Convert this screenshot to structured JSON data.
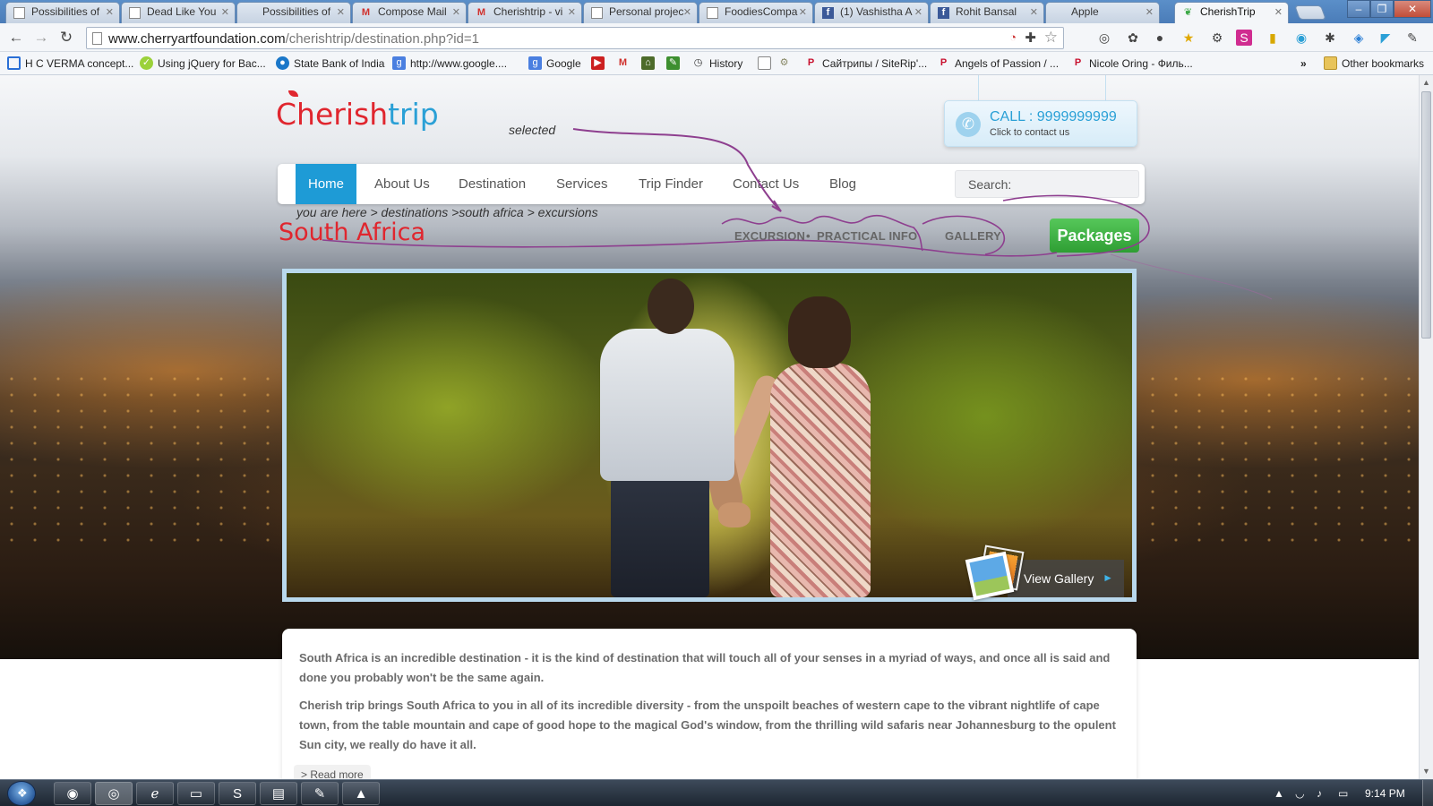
{
  "browser": {
    "tabs": [
      {
        "title": "Possibilities of",
        "icon": "page-icon"
      },
      {
        "title": "Dead Like You",
        "icon": "page-icon"
      },
      {
        "title": "Possibilities of",
        "icon": "page-icon"
      },
      {
        "title": "Compose Mail",
        "icon": "gmail-icon"
      },
      {
        "title": "Cherishtrip - vi",
        "icon": "gmail-icon"
      },
      {
        "title": "Personal projec",
        "icon": "page-icon"
      },
      {
        "title": "FoodiesCompa",
        "icon": "page-icon"
      },
      {
        "title": "(1) Vashistha A",
        "icon": "facebook-icon"
      },
      {
        "title": "Rohit Bansal",
        "icon": "facebook-icon"
      },
      {
        "title": "Apple",
        "icon": "apple-icon"
      },
      {
        "title": "CherishTrip",
        "icon": "leaf-icon"
      }
    ],
    "active_tab": 10,
    "url_host": "www.cherryartfoundation.com",
    "url_path": "/cherishtrip/destination.php?id=1",
    "bookmarks": [
      {
        "label": "H C VERMA concept...",
        "icon": "blue-square-icon"
      },
      {
        "label": "Using jQuery for Bac...",
        "icon": "green-circle-icon"
      },
      {
        "label": "State Bank of India",
        "icon": "sbi-icon"
      },
      {
        "label": "http://www.google....",
        "icon": "google-icon"
      },
      {
        "label": "Google",
        "icon": "google-icon"
      },
      {
        "label": "",
        "icon": "youtube-icon"
      },
      {
        "label": "",
        "icon": "gmail-icon"
      },
      {
        "label": "",
        "icon": "home-icon"
      },
      {
        "label": "",
        "icon": "evernote-icon"
      },
      {
        "label": "History",
        "icon": "history-icon"
      },
      {
        "label": "",
        "icon": "page-icon"
      },
      {
        "label": "",
        "icon": "lock-icon"
      },
      {
        "label": "Сайтрипы / SiteRip'...",
        "icon": "p-icon"
      },
      {
        "label": "Angels of Passion / ...",
        "icon": "p-icon"
      },
      {
        "label": "Nicole Oring - Филь...",
        "icon": "p-icon"
      },
      {
        "label": "Other bookmarks",
        "icon": "folder-icon"
      }
    ],
    "bookmarks_overflow": "»"
  },
  "site": {
    "logo_part1": "Cherish",
    "logo_part2": "trip",
    "annotation": "selected",
    "call_label": "CALL : 9999999999",
    "call_sub": "Click to contact us",
    "nav": [
      "Home",
      "About Us",
      "Destination",
      "Services",
      "Trip Finder",
      "Contact Us",
      "Blog"
    ],
    "nav_active": "Home",
    "search_placeholder": "Search:",
    "breadcrumb": "you are here > destinations >south africa > excursions",
    "title": "South Africa",
    "subnav": {
      "excursion": "EXCURSION",
      "sep": "•",
      "practical": "PRACTICAL INFO",
      "gallery": "GALLERY"
    },
    "packages_label": "Packages",
    "view_gallery": "View Gallery",
    "view_gallery_arrow": "►",
    "para1": "South Africa is an incredible destination - it is the kind of destination that will touch all of your senses in a myriad of ways, and once all is said and done you probably won't be the same again.",
    "para2": "Cherish trip brings South Africa to you in all of its incredible diversity - from the unspoilt beaches of western cape to the vibrant nightlife of cape town, from the table mountain and cape of good hope to the magical God's window, from the thrilling wild safaris near Johannesburg to the opulent Sun city, we really do have it all.",
    "read_more": "> Read more"
  },
  "taskbar": {
    "apps": [
      "firefox-icon",
      "chrome-icon",
      "ie-icon",
      "explorer-icon",
      "skype-icon",
      "notepad-icon",
      "notes-icon",
      "vlc-icon"
    ],
    "clock": "9:14 PM"
  },
  "colors": {
    "brand_red": "#e0262e",
    "brand_blue": "#1e9bd6",
    "packages_green": "#3aae3e",
    "annotation_purple": "#8e3f8f"
  }
}
